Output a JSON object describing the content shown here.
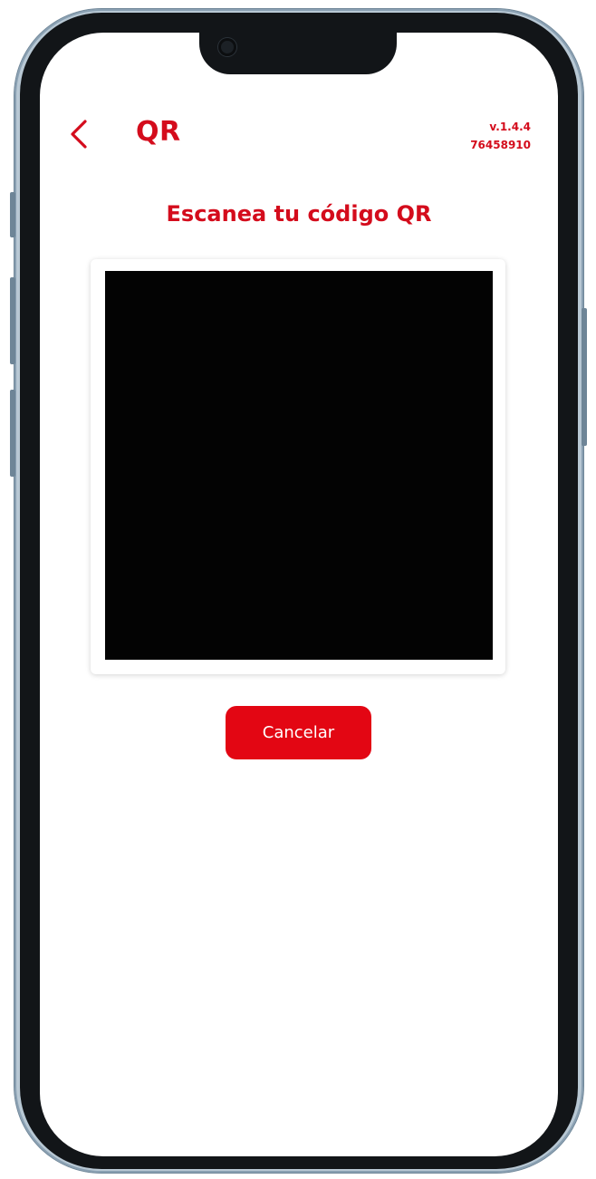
{
  "header": {
    "back_icon": "chevron-left-icon",
    "title": "QR",
    "version": "v.1.4.4",
    "id_number": "76458910"
  },
  "scanner": {
    "heading": "Escanea tu código QR"
  },
  "actions": {
    "cancel_label": "Cancelar"
  },
  "colors": {
    "accent": "#d40c1c",
    "button": "#e30613",
    "camera_view": "#030303"
  }
}
